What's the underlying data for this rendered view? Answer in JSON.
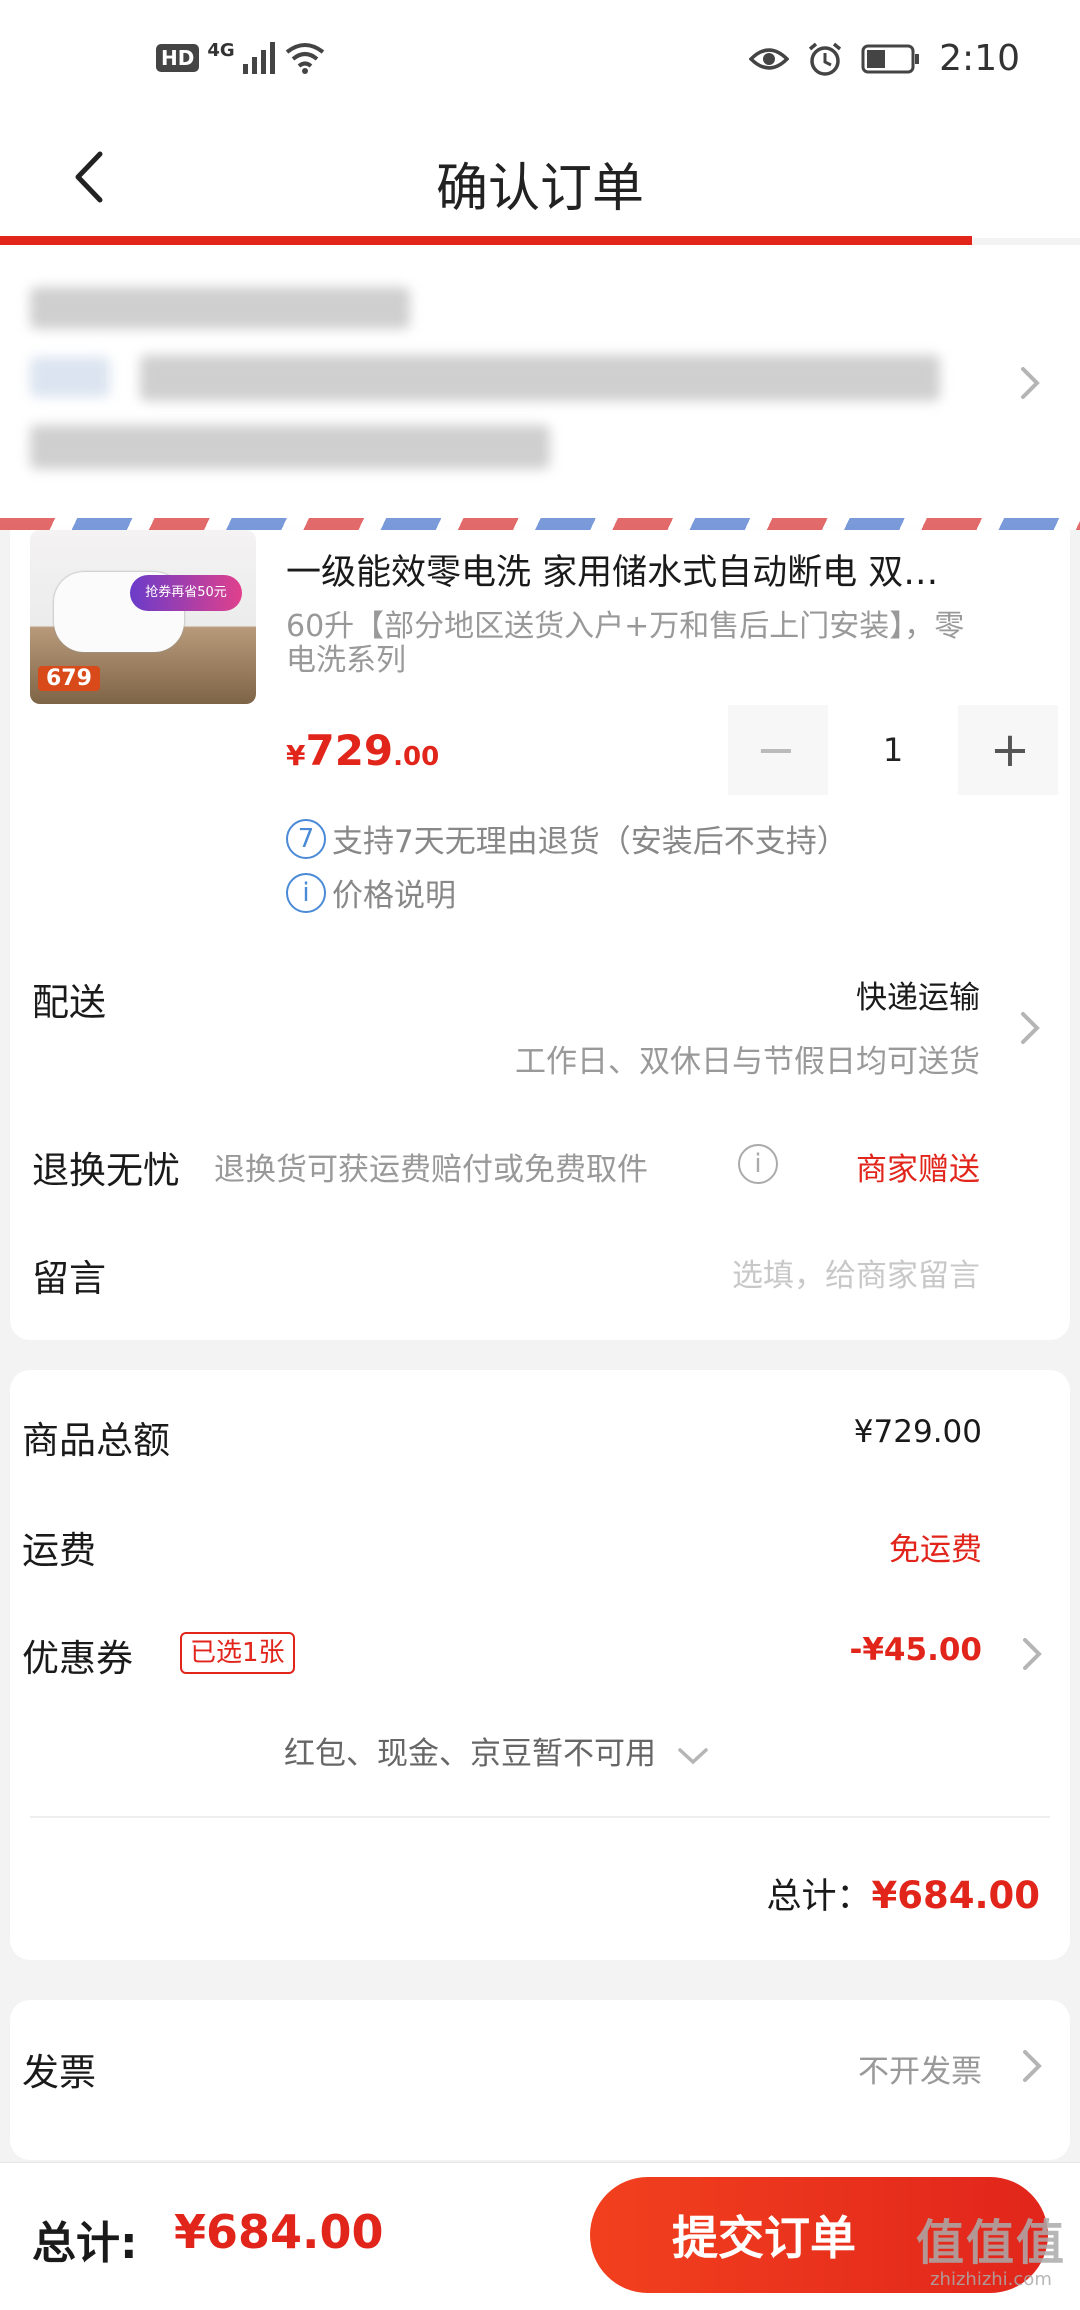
{
  "status_bar": {
    "hd": "HD",
    "network": "4G",
    "time": "2:10"
  },
  "header": {
    "title": "确认订单"
  },
  "product": {
    "title": "一级能效零电洗 家用储水式自动断电 双…",
    "spec": "60升【部分地区送货入户+万和售后上门安装】，零电洗系列",
    "price_currency": "¥",
    "price_integer": "729",
    "price_decimal": ".00",
    "quantity": "1",
    "minus": "−",
    "plus": "+",
    "image_promo": "抢券再省50元",
    "image_price": "679",
    "return_note_icon": "7",
    "return_note": "支持7天无理由退货（安装后不支持）",
    "price_explain": "价格说明"
  },
  "delivery": {
    "label": "配送",
    "method": "快递运输",
    "time_note": "工作日、双休日与节假日均可送货"
  },
  "return_worry_free": {
    "label": "退换无忧",
    "desc": "退换货可获运费赔付或免费取件",
    "value": "商家赠送"
  },
  "message": {
    "label": "留言",
    "placeholder": "选填，给商家留言"
  },
  "summary": {
    "goods_total_label": "商品总额",
    "goods_total": "¥729.00",
    "shipping_label": "运费",
    "shipping_value": "免运费",
    "coupon_label": "优惠券",
    "coupon_badge": "已选1张",
    "coupon_value": "-¥45.00",
    "unavailable_note": "红包、现金、京豆暂不可用",
    "total_label": "总计：",
    "total_value": "¥684.00"
  },
  "invoice": {
    "label": "发票",
    "value": "不开发票"
  },
  "bottom_bar": {
    "total_label": "总计:",
    "total_value": "¥684.00",
    "submit_label": "提交订单",
    "watermark": "值值值",
    "watermark_url": "zhizhizhi.com"
  },
  "colors": {
    "accent": "#e1251b",
    "info_blue": "#4a8ad6"
  }
}
